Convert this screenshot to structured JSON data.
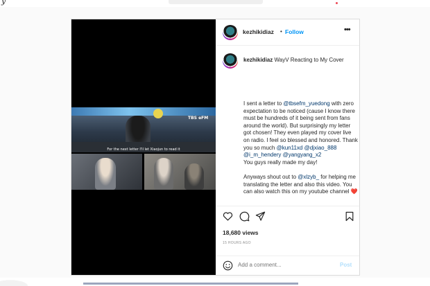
{
  "post": {
    "username": "kezhikidiaz",
    "follow_label": "Follow",
    "more_label": "•••",
    "caption_title": "WayV Reacting to My Cover",
    "video_subtitle": "For the next letter I'll let Xiaojun to read it",
    "body_segments": [
      {
        "text": "I sent a letter to ",
        "mention": false
      },
      {
        "text": "@tbsefm_yuedong",
        "mention": true
      },
      {
        "text": " with zero expectation to be noticed (cause I know there must be hundreds of it being sent from fans around the world). But surprisingly my letter got chosen! They even played my cover live on radio. I feel so blessed and honored. Thank you so much ",
        "mention": false
      },
      {
        "text": "@kun11xd",
        "mention": true
      },
      {
        "text": " ",
        "mention": false
      },
      {
        "text": "@djxiao_888",
        "mention": true
      },
      {
        "text": " ",
        "mention": false
      },
      {
        "text": "@i_m_hendery",
        "mention": true
      },
      {
        "text": " ",
        "mention": false
      },
      {
        "text": "@yangyang_x2",
        "mention": true
      },
      {
        "text": "\nYou guys really made my day!\n\nAnyways shout out to ",
        "mention": false
      },
      {
        "text": "@xlzyb_",
        "mention": true
      },
      {
        "text": " for helping me translating the letter and also this video. You can also watch this on my youtube channel ❤️",
        "mention": false
      }
    ],
    "views": "18,680 views",
    "time": "15 HOURS AGO",
    "comment_placeholder": "Add a comment...",
    "post_label": "Post"
  },
  "video": {
    "channel_logo": "TBS eFM"
  },
  "icons": [
    "heart-icon",
    "comment-icon",
    "share-icon",
    "bookmark-icon",
    "emoji-icon"
  ],
  "colors": {
    "link": "#0095f6",
    "mention": "#00376b",
    "post_disabled": "#b2dffc",
    "muted": "#8e8e8e",
    "border": "#dbdbdb"
  }
}
